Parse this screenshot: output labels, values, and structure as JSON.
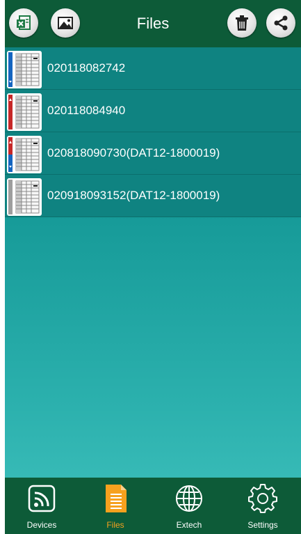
{
  "header": {
    "title": "Files",
    "left_icons": [
      "excel-export-icon",
      "image-icon"
    ],
    "right_icons": [
      "trash-icon",
      "share-icon"
    ]
  },
  "files": [
    {
      "name": "020118082742",
      "indicator": "blue-down"
    },
    {
      "name": "020118084940",
      "indicator": "red-up"
    },
    {
      "name": "020818090730(DAT12-1800019)",
      "indicator": "red-up-blue-down"
    },
    {
      "name": "020918093152(DAT12-1800019)",
      "indicator": "gray"
    }
  ],
  "nav": [
    {
      "label": "Devices",
      "icon": "devices-icon",
      "active": false
    },
    {
      "label": "Files",
      "icon": "files-icon",
      "active": true
    },
    {
      "label": "Extech",
      "icon": "globe-icon",
      "active": false
    },
    {
      "label": "Settings",
      "icon": "gear-icon",
      "active": false
    }
  ],
  "colors": {
    "header_bg": "#0d5b38",
    "row_bg": "#0f8381",
    "active_tab": "#f6a11e",
    "indicator_blue": "#1565c0",
    "indicator_red": "#c62828"
  }
}
